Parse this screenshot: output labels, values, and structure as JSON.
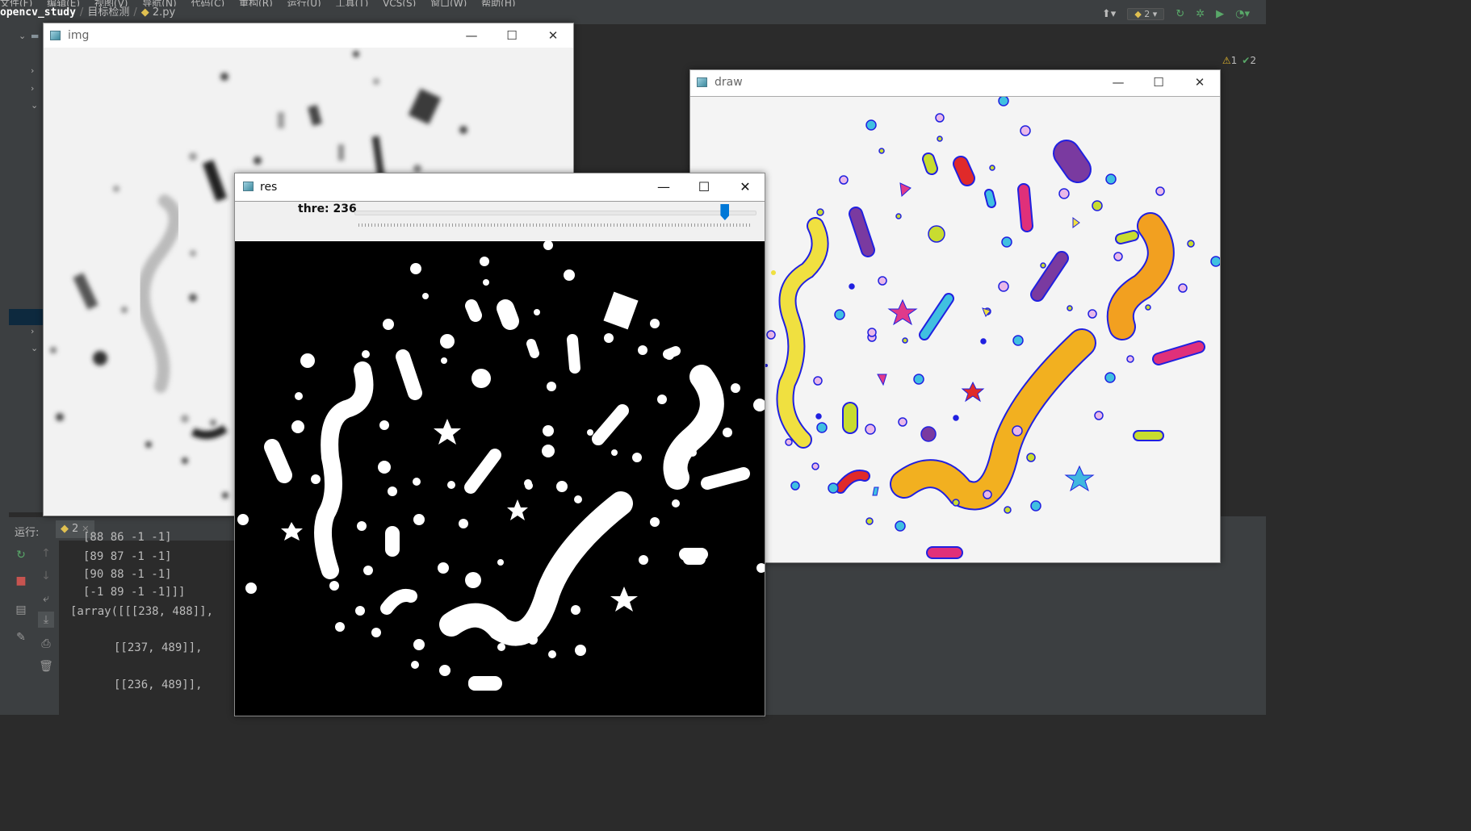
{
  "ide": {
    "menu": [
      "文件(F)",
      "编辑(E)",
      "视图(V)",
      "导航(N)",
      "代码(C)",
      "重构(R)",
      "运行(U)",
      "工具(T)",
      "VCS(S)",
      "窗口(W)",
      "帮助(H)"
    ],
    "breadcrumb": {
      "project": "opencv_study",
      "folder": "目标检测",
      "file": "2.py"
    },
    "run_config": "2",
    "inspections": {
      "warnings": "1",
      "ok": "2"
    },
    "run_panel_label": "运行:",
    "run_tab": "2",
    "console_lines": [
      "[88 86 -1 -1]",
      "[89 87 -1 -1]",
      "[90 88 -1 -1]",
      "[-1 89 -1 -1]]]",
      "[array([[[238, 488]],",
      "[[237, 489]],",
      "[[236, 489]],"
    ]
  },
  "windows": {
    "img": {
      "title": "img"
    },
    "res": {
      "title": "res",
      "trackbar": {
        "label": "thre: 236",
        "name": "thre",
        "value": 236,
        "max": 255
      }
    },
    "draw": {
      "title": "draw"
    }
  },
  "colors": {
    "ide_bg": "#2b2b2b",
    "ide_panel": "#3c3f41",
    "trackbar_thumb": "#0078d7",
    "contour": "#2020e0"
  }
}
